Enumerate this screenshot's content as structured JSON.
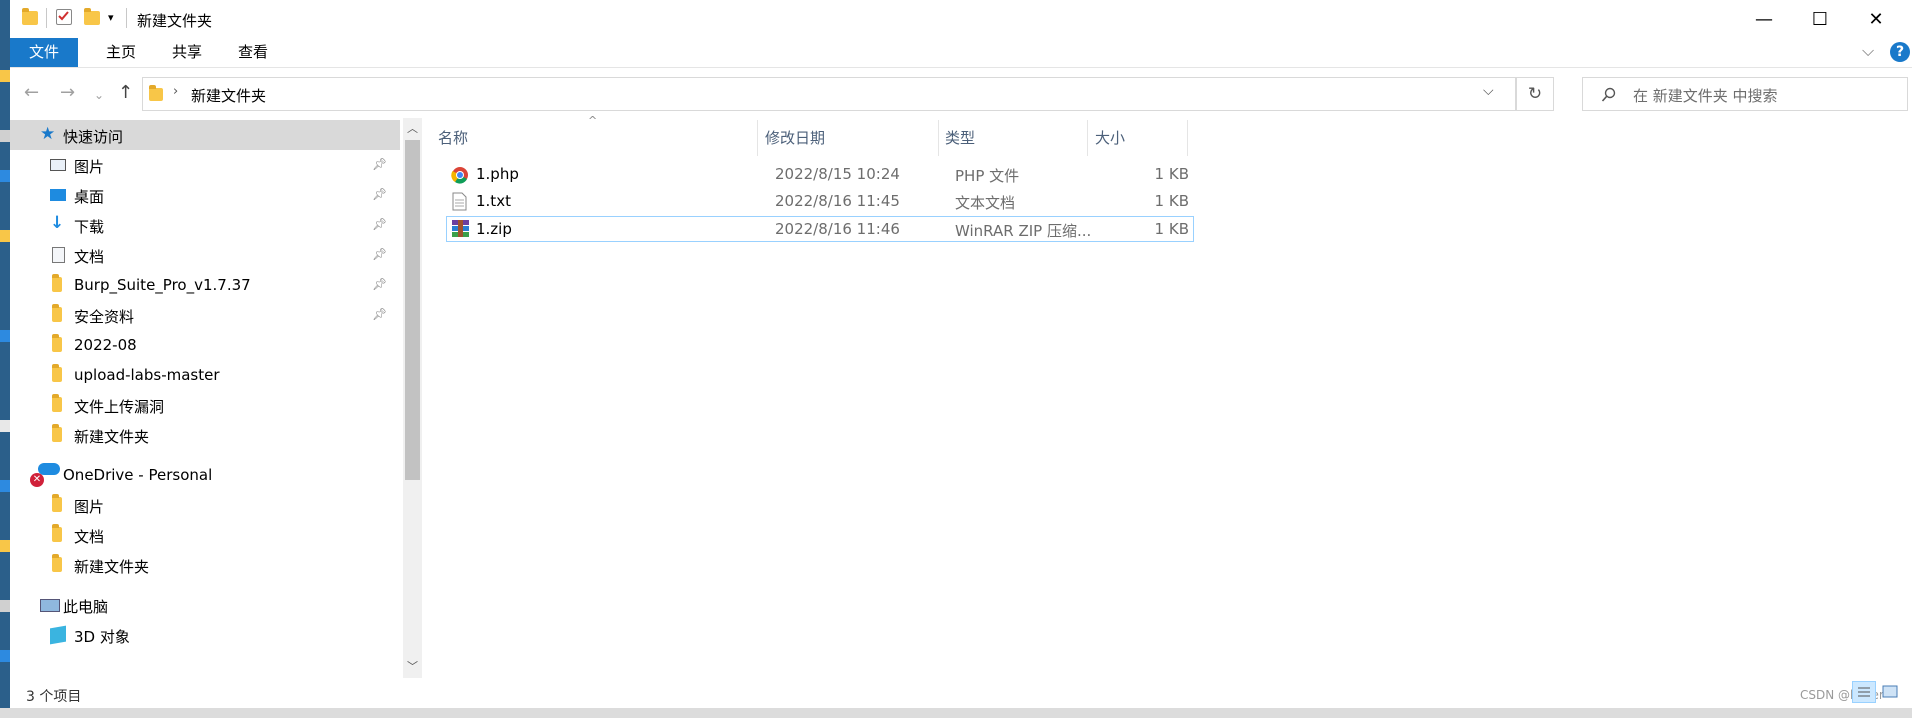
{
  "window": {
    "title": "新建文件夹",
    "minimize_glyph": "—",
    "maximize_glyph": "☐",
    "close_glyph": "✕"
  },
  "ribbon": {
    "tabs": [
      "文件",
      "主页",
      "共享",
      "查看"
    ],
    "collapse_glyph": "⌵",
    "help_glyph": "?"
  },
  "address": {
    "breadcrumb": "新建文件夹",
    "search_placeholder": "在 新建文件夹 中搜索"
  },
  "nav": {
    "quick_access": "快速访问",
    "quick_items": [
      "图片",
      "桌面",
      "下载",
      "文档",
      "Burp_Suite_Pro_v1.7.37",
      "安全资料",
      "2022-08",
      "upload-labs-master",
      "文件上传漏洞",
      "新建文件夹"
    ],
    "onedrive": "OneDrive - Personal",
    "onedrive_items": [
      "图片",
      "文档",
      "新建文件夹"
    ],
    "this_pc": "此电脑",
    "pc_items": [
      "3D 对象"
    ]
  },
  "columns": {
    "name": "名称",
    "date": "修改日期",
    "type": "类型",
    "size": "大小"
  },
  "files": [
    {
      "name": "1.php",
      "date": "2022/8/15 10:24",
      "type": "PHP 文件",
      "size": "1 KB",
      "icon": "chrome-icon"
    },
    {
      "name": "1.txt",
      "date": "2022/8/16 11:45",
      "type": "文本文档",
      "size": "1 KB",
      "icon": "text-file-icon"
    },
    {
      "name": "1.zip",
      "date": "2022/8/16 11:46",
      "type": "WinRAR ZIP 压缩...",
      "size": "1 KB",
      "icon": "winrar-icon"
    }
  ],
  "status": {
    "item_count": "3 个项目"
  },
  "watermark": "CSDN @baker",
  "colors": {
    "accent": "#1979ca",
    "folder": "#f8c648",
    "selection_border": "#99d1ff"
  }
}
